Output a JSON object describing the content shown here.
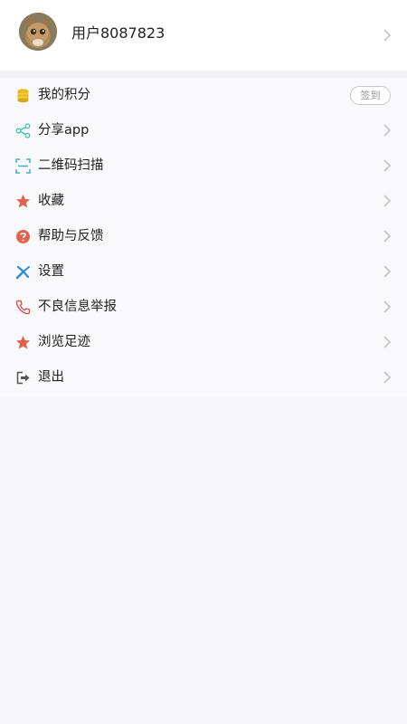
{
  "profile": {
    "username": "用户8087823",
    "avatar_icon": "cat-avatar-icon"
  },
  "menu": {
    "items": [
      {
        "label": "我的积分",
        "icon": "coins-icon",
        "icon_color": "#e9b81c",
        "badge": "签到"
      },
      {
        "label": "分享app",
        "icon": "share-icon",
        "icon_color": "#3fbfb6"
      },
      {
        "label": "二维码扫描",
        "icon": "qr-scan-icon",
        "icon_color": "#3ab0d6"
      },
      {
        "label": "收藏",
        "icon": "star-icon",
        "icon_color": "#e4614b"
      },
      {
        "label": "帮助与反馈",
        "icon": "help-icon",
        "icon_color": "#e4614b"
      },
      {
        "label": "设置",
        "icon": "settings-icon",
        "icon_color": "#2b8fd8"
      },
      {
        "label": "不良信息举报",
        "icon": "phone-icon",
        "icon_color": "#d9534f"
      },
      {
        "label": "浏览足迹",
        "icon": "star-icon",
        "icon_color": "#e4614b"
      },
      {
        "label": "退出",
        "icon": "logout-icon",
        "icon_color": "#555555"
      }
    ]
  },
  "colors": {
    "background": "#f7f7f9",
    "chevron": "#c4c4c4"
  }
}
